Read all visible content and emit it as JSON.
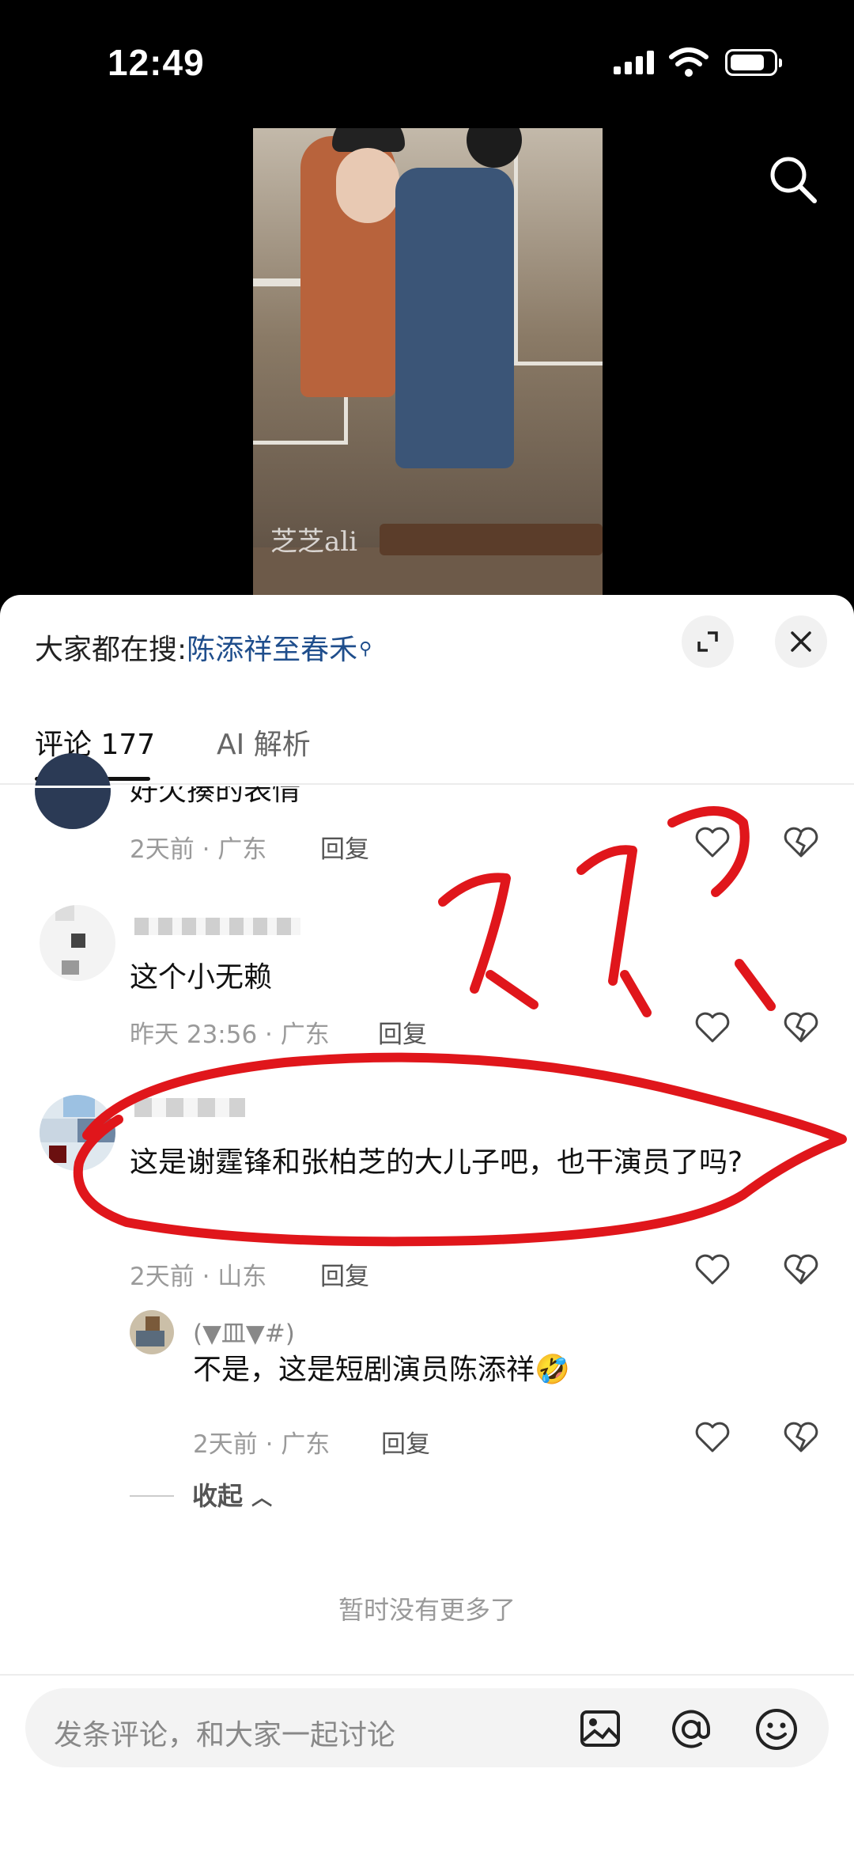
{
  "status_bar": {
    "time": "12:49"
  },
  "video": {
    "watermark": "芝芝ali"
  },
  "search_suggestion": {
    "label": "大家都在搜:",
    "query": "陈添祥至春禾"
  },
  "tabs": [
    {
      "label": "评论 177",
      "active": true
    },
    {
      "label": "AI 解析",
      "active": false
    }
  ],
  "comments": [
    {
      "username": "",
      "text": "好欠揍的表情",
      "time_location": "2天前 · 广东",
      "reply_label": "回复"
    },
    {
      "username": "",
      "text": "这个小无赖",
      "time_location": "昨天 23:56 · 广东",
      "reply_label": "回复"
    },
    {
      "username": "",
      "text": "这是谢霆锋和张柏芝的大儿子吧，也干演员了吗?",
      "time_location": "2天前 · 山东",
      "reply_label": "回复",
      "replies": [
        {
          "username": "(▼皿▼#)",
          "text": "不是，这是短剧演员陈添祥🤣",
          "time_location": "2天前 · 广东",
          "reply_label": "回复"
        }
      ]
    }
  ],
  "collapse_label": "收起",
  "no_more_text": "暂时没有更多了",
  "comment_input": {
    "placeholder": "发条评论，和大家一起讨论"
  },
  "icons": [
    "search-icon",
    "expand-icon",
    "close-icon",
    "heart-icon",
    "dislike-icon",
    "image-icon",
    "at-icon",
    "emoji-icon"
  ],
  "colors": {
    "annotation_red": "#e0161b",
    "link_blue": "#1f4e8c"
  }
}
